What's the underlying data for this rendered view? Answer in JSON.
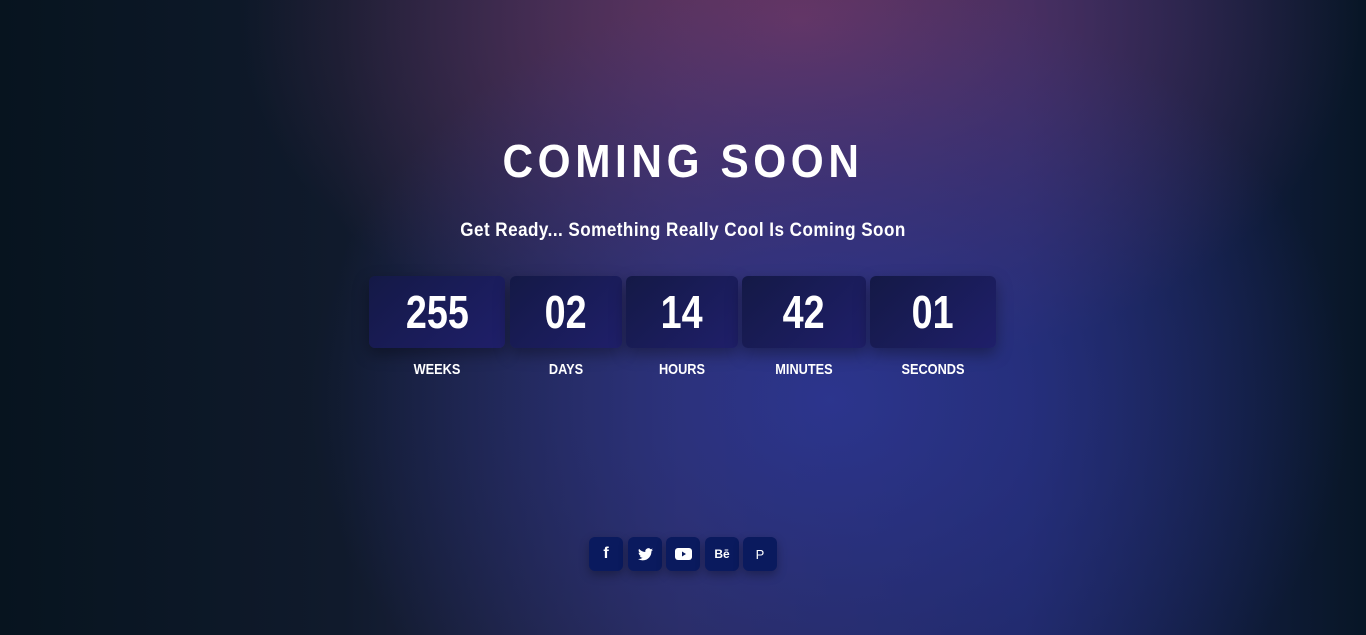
{
  "title": "COMING SOON",
  "subtitle": "Get Ready... Something Really Cool Is Coming Soon",
  "countdown": [
    {
      "value": "255",
      "label": "WEEKS"
    },
    {
      "value": "02",
      "label": "DAYS"
    },
    {
      "value": "14",
      "label": "HOURS"
    },
    {
      "value": "42",
      "label": "MINUTES"
    },
    {
      "value": "01",
      "label": "SECONDS"
    }
  ],
  "social": [
    {
      "icon": "facebook-icon",
      "glyph": "f"
    },
    {
      "icon": "twitter-icon"
    },
    {
      "icon": "youtube-icon"
    },
    {
      "icon": "behance-icon",
      "glyph": "Bē"
    },
    {
      "icon": "pinterest-icon",
      "glyph": "P"
    }
  ]
}
